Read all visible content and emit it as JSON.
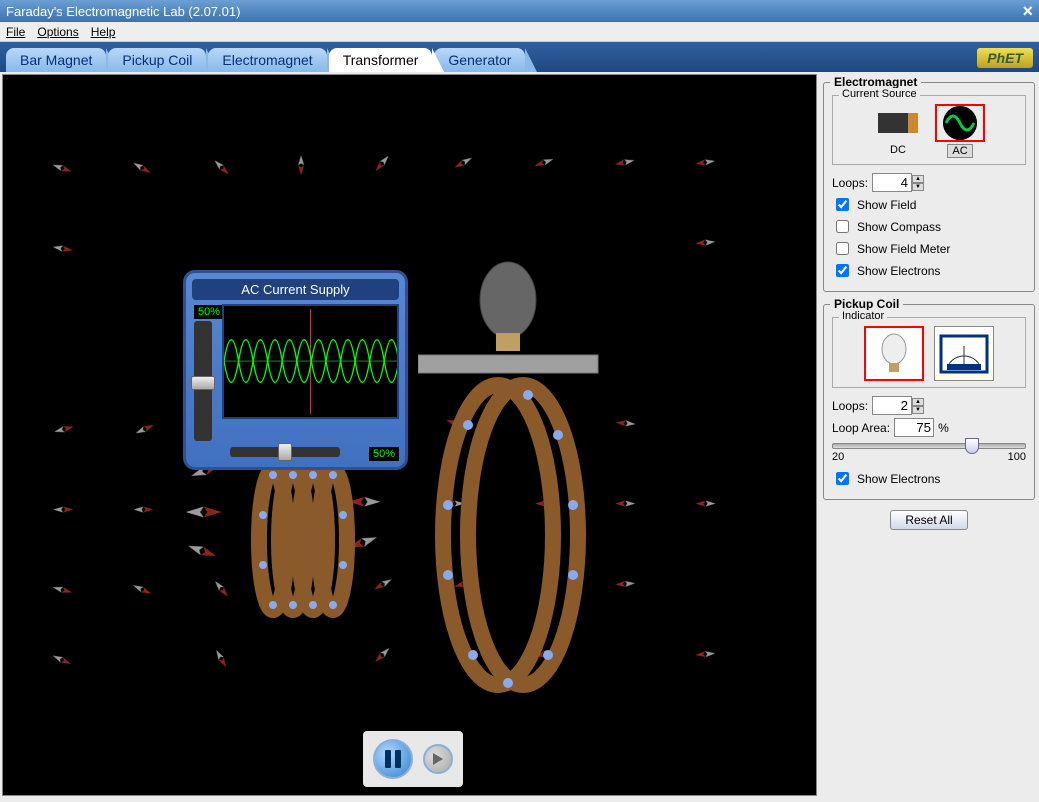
{
  "window": {
    "title": "Faraday's Electromagnetic Lab (2.07.01)",
    "close": "×"
  },
  "menu": {
    "file": "File",
    "options": "Options",
    "help": "Help"
  },
  "tabs": {
    "bar_magnet": "Bar Magnet",
    "pickup_coil": "Pickup Coil",
    "electromagnet": "Electromagnet",
    "transformer": "Transformer",
    "generator": "Generator"
  },
  "logo": "PhET",
  "ac_supply": {
    "title": "AC Current Supply",
    "amp_pct": "50%",
    "freq_pct": "50%"
  },
  "electromagnet_panel": {
    "title": "Electromagnet",
    "source_title": "Current Source",
    "dc": "DC",
    "ac": "AC",
    "loops_label": "Loops:",
    "loops_value": "4",
    "show_field": "Show Field",
    "show_compass": "Show Compass",
    "show_field_meter": "Show Field Meter",
    "show_electrons": "Show Electrons"
  },
  "pickup_panel": {
    "title": "Pickup Coil",
    "indicator_title": "Indicator",
    "loops_label": "Loops:",
    "loops_value": "2",
    "area_label": "Loop Area:",
    "area_value": "75",
    "area_unit": "%",
    "area_min": "20",
    "area_max": "100",
    "show_electrons": "Show Electrons"
  },
  "reset": "Reset All",
  "checkboxes": {
    "show_field": true,
    "show_compass": false,
    "show_field_meter": false,
    "show_electrons_em": true,
    "show_electrons_pc": true
  }
}
